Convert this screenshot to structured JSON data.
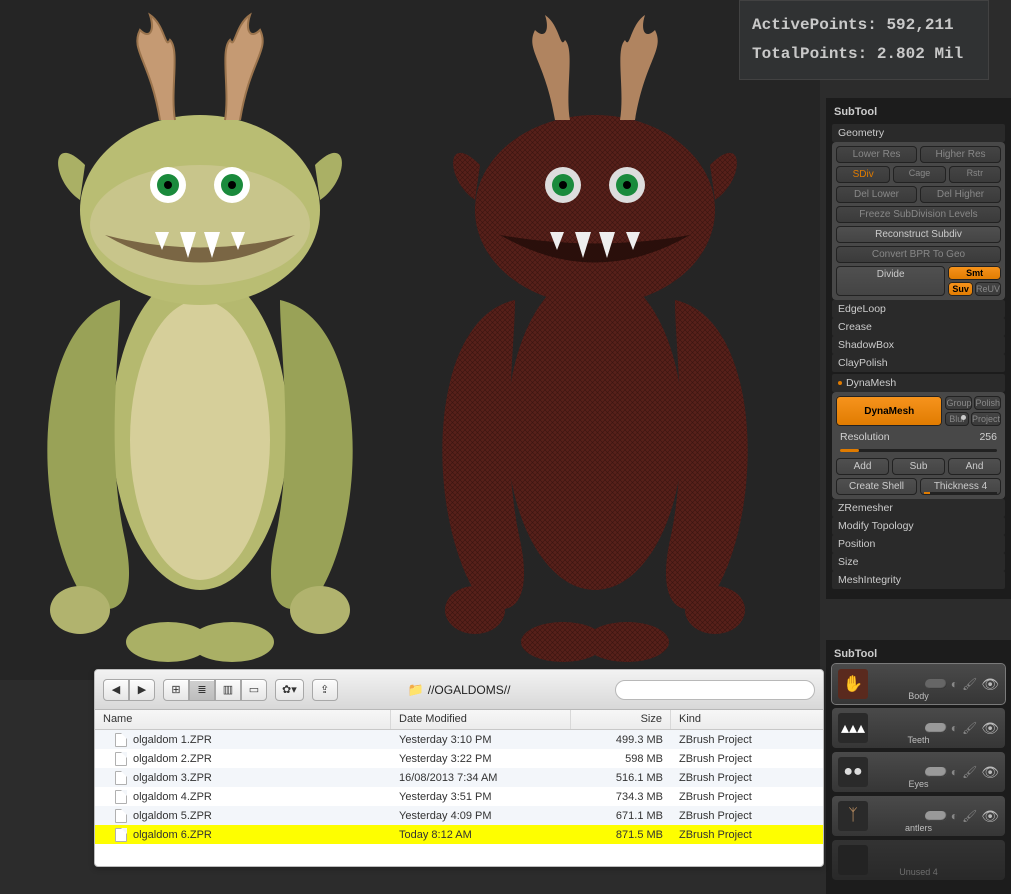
{
  "stats": {
    "active_label": "ActivePoints:",
    "active_value": "592,211",
    "total_label": "TotalPoints:",
    "total_value": "2.802 Mil"
  },
  "panel": {
    "title1": "SubTool",
    "geometry": {
      "header": "Geometry",
      "lower_res": "Lower Res",
      "higher_res": "Higher Res",
      "sdiv": "SDiv",
      "cage": "Cage",
      "rstr": "Rstr",
      "del_lower": "Del Lower",
      "del_higher": "Del Higher",
      "freeze": "Freeze SubDivision Levels",
      "reconstruct": "Reconstruct Subdiv",
      "convert": "Convert BPR To Geo",
      "divide": "Divide",
      "smt": "Smt",
      "suv": "Suv",
      "reuv": "ReUV"
    },
    "sections": {
      "edgeloop": "EdgeLoop",
      "crease": "Crease",
      "shadowbox": "ShadowBox",
      "claypolish": "ClayPolish",
      "dynamesh": "DynaMesh",
      "zremesher": "ZRemesher",
      "modify": "Modify Topology",
      "position": "Position",
      "size": "Size",
      "meshintegrity": "MeshIntegrity"
    },
    "dyna": {
      "btn": "DynaMesh",
      "group": "Group",
      "polish": "Polish",
      "blur": "Blur",
      "project": "Project",
      "resolution_label": "Resolution",
      "resolution_value": "256",
      "add": "Add",
      "sub": "Sub",
      "and": "And",
      "create_shell": "Create Shell",
      "thickness_label": "Thickness",
      "thickness_value": "4"
    }
  },
  "subtool": {
    "title": "SubTool",
    "items": [
      {
        "name": "Body"
      },
      {
        "name": "Teeth"
      },
      {
        "name": "Eyes"
      },
      {
        "name": "antlers"
      },
      {
        "name": "Unused 4"
      }
    ]
  },
  "finder": {
    "path": "//OGALDOMS//",
    "search_placeholder": "",
    "columns": {
      "name": "Name",
      "date": "Date Modified",
      "size": "Size",
      "kind": "Kind"
    },
    "rows": [
      {
        "name": "olgaldom 1.ZPR",
        "date": "Yesterday 3:10 PM",
        "size": "499.3 MB",
        "kind": "ZBrush Project",
        "selected": false
      },
      {
        "name": "olgaldom 2.ZPR",
        "date": "Yesterday 3:22 PM",
        "size": "598 MB",
        "kind": "ZBrush Project",
        "selected": false
      },
      {
        "name": "olgaldom 3.ZPR",
        "date": "16/08/2013 7:34 AM",
        "size": "516.1 MB",
        "kind": "ZBrush Project",
        "selected": false
      },
      {
        "name": "olgaldom 4.ZPR",
        "date": "Yesterday 3:51 PM",
        "size": "734.3 MB",
        "kind": "ZBrush Project",
        "selected": false
      },
      {
        "name": "olgaldom 5.ZPR",
        "date": "Yesterday 4:09 PM",
        "size": "671.1 MB",
        "kind": "ZBrush Project",
        "selected": false
      },
      {
        "name": "olgaldom 6.ZPR",
        "date": "Today 8:12 AM",
        "size": "871.5 MB",
        "kind": "ZBrush Project",
        "selected": true
      }
    ]
  }
}
